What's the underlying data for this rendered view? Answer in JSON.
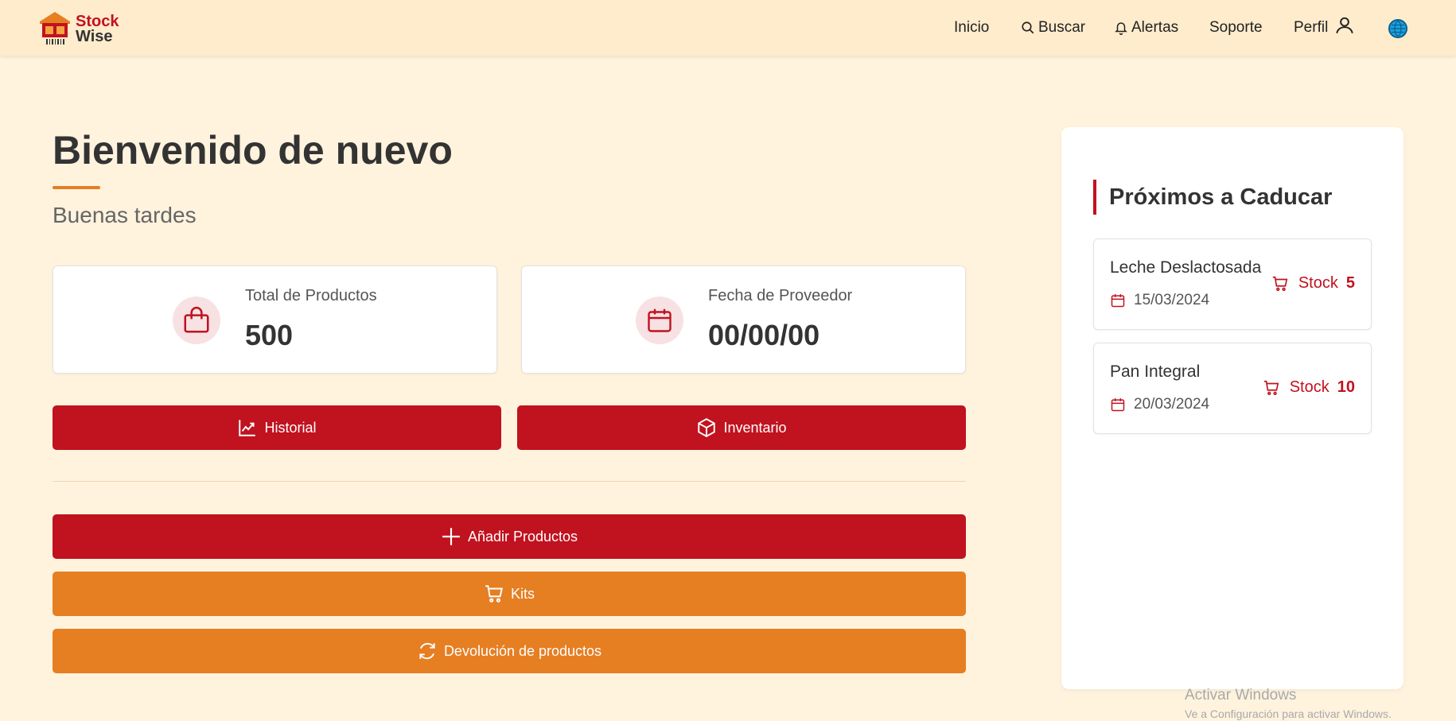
{
  "app": {
    "logo_line1": "Stock",
    "logo_line2": "Wise"
  },
  "nav": {
    "inicio": "Inicio",
    "buscar": "Buscar",
    "alertas": "Alertas",
    "soporte": "Soporte",
    "perfil": "Perfil",
    "language_icon": "globe-icon"
  },
  "main": {
    "title": "Bienvenido de nuevo",
    "greeting": "Buenas tardes",
    "stats": [
      {
        "label": "Total de Productos",
        "value": "500",
        "icon": "shopping-bag-icon"
      },
      {
        "label": "Fecha de Proveedor",
        "value": "00/00/00",
        "icon": "calendar-icon"
      }
    ],
    "buttons": {
      "historial": "Historial",
      "inventario": "Inventario",
      "anadir": "Añadir Productos",
      "kits": "Kits",
      "devolucion": "Devolución de productos"
    }
  },
  "expiring": {
    "title": "Próximos a Caducar",
    "items": [
      {
        "name": "Leche Deslactosada",
        "date": "15/03/2024",
        "stock_label": "Stock",
        "stock": "5"
      },
      {
        "name": "Pan Integral",
        "date": "20/03/2024",
        "stock_label": "Stock",
        "stock": "10"
      }
    ]
  },
  "watermark": {
    "line1": "Activar Windows",
    "line2": "Ve a Configuración para activar Windows."
  },
  "colors": {
    "primary": "#c1121f",
    "accent": "#e67e22",
    "background": "#fff3de",
    "header": "#ffeccc"
  }
}
